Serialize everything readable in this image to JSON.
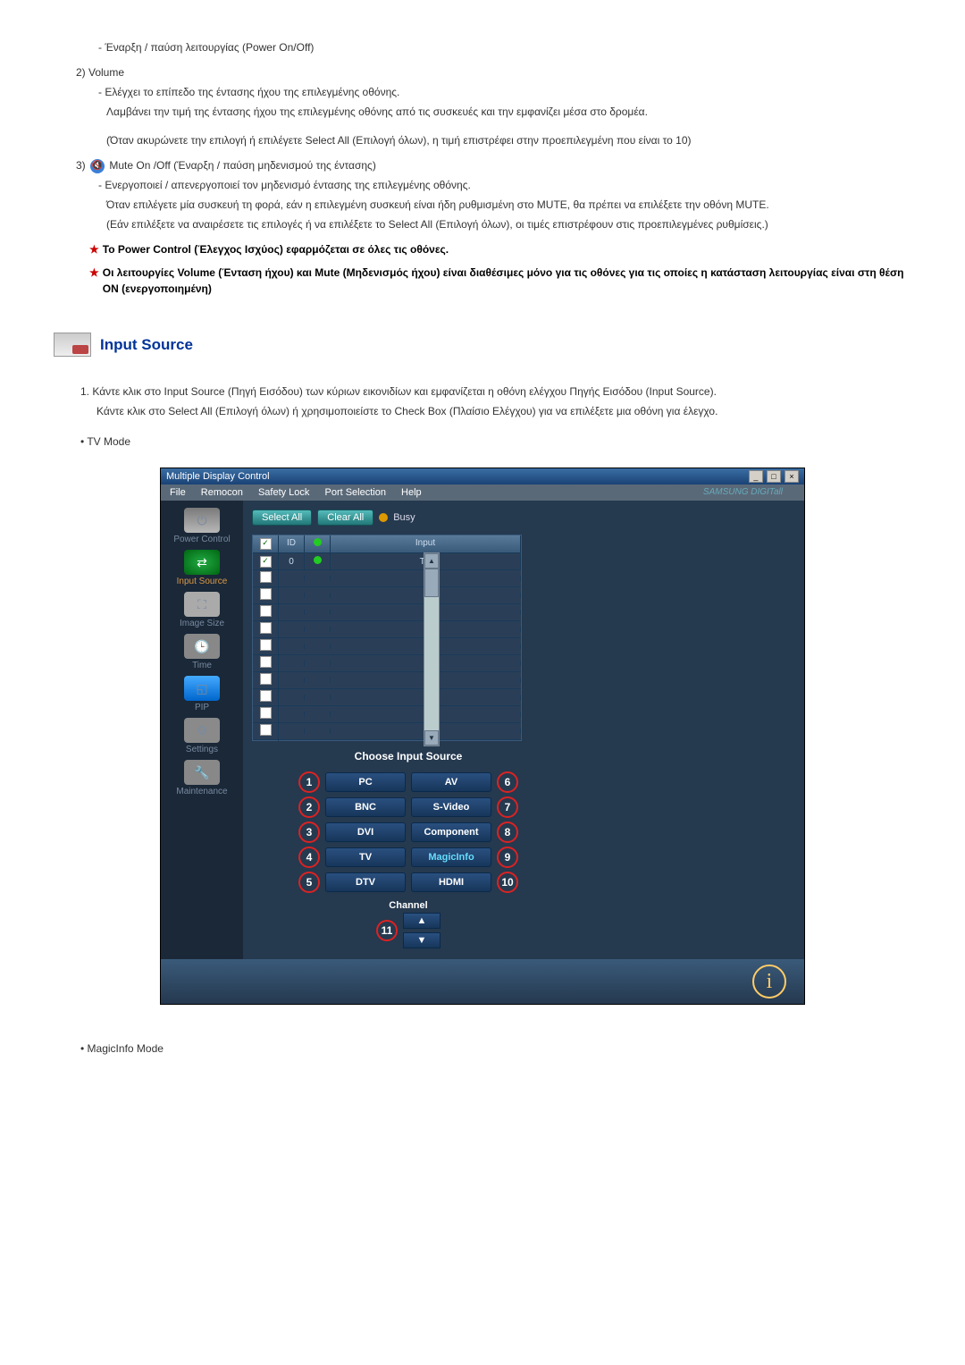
{
  "item1": {
    "dash": "- Έναρξη / παύση λειτουργίας (Power On/Off)"
  },
  "item2": {
    "label": "2)  Volume",
    "dash1": "- Ελέγχει το επίπεδο της έντασης ήχου της επιλεγμένης οθόνης.",
    "line2": "Λαμβάνει την τιμή της έντασης ήχου της επιλεγμένης οθόνης από τις συσκευές και την εμφανίζει μέσα στο δρομέα.",
    "line3": "(Όταν ακυρώνετε την επιλογή ή επιλέγετε Select All (Επιλογή όλων), η τιμή επιστρέφει στην προεπιλεγμένη που είναι το 10)"
  },
  "item3": {
    "label_pre": "3)",
    "label_post": "Mute On /Off (Έναρξη / παύση μηδενισμού της έντασης)",
    "dash1": "- Ενεργοποιεί / απενεργοποιεί τον μηδενισμό έντασης της επιλεγμένης οθόνης.",
    "line2": "Όταν επιλέγετε μία συσκευή τη φορά, εάν η επιλεγμένη συσκευή είναι ήδη ρυθμισμένη στο MUTE, θα πρέπει να επιλέξετε την οθόνη MUTE.",
    "line3": "(Εάν επιλέξετε να αναιρέσετε τις επιλογές ή να επιλέξετε το Select All (Επιλογή όλων), οι τιμές επιστρέφουν στις προεπιλεγμένες ρυθμίσεις.)"
  },
  "star1": "Το Power Control (Έλεγχος Ισχύος) εφαρμόζεται σε όλες τις οθόνες.",
  "star2": "Οι λειτουργίες Volume (Ένταση ήχου) και Mute (Μηδενισμός ήχου) είναι διαθέσιμες μόνο για τις οθόνες για τις οποίες η κατάσταση λειτουργίας είναι στη θέση ON (ενεργοποιημένη)",
  "section_title": "Input Source",
  "numlist": {
    "n1": "1.  Κάντε κλικ στο Input Source (Πηγή Εισόδου) των κύριων εικονιδίων και εμφανίζεται η οθόνη ελέγχου Πηγής Εισόδου (Input Source).",
    "n1b": "Κάντε κλικ στο Select All (Επιλογή όλων) ή χρησιμοποιείστε το Check Box (Πλαίσιο Ελέγχου) για να επιλέξετε μια οθόνη για έλεγχο."
  },
  "bullet_tv": "TV Mode",
  "bullet_magic": "MagicInfo Mode",
  "screenshot": {
    "title": "Multiple Display Control",
    "menu": {
      "file": "File",
      "remocon": "Remocon",
      "safety": "Safety Lock",
      "port": "Port Selection",
      "help": "Help",
      "brand": "SAMSUNG DIGITall"
    },
    "btn_selectall": "Select All",
    "btn_clearall": "Clear All",
    "busy": "Busy",
    "sidebar": {
      "pc": "Power Control",
      "is": "Input Source",
      "sz": "Image Size",
      "tm": "Time",
      "pip": "PIP",
      "st": "Settings",
      "mt": "Maintenance"
    },
    "table": {
      "h_id": "ID",
      "h_input": "Input",
      "row0_id": "0",
      "row0_input": "TV"
    },
    "right": {
      "head": "Choose Input Source",
      "n1": "1",
      "b1": "PC",
      "n2": "2",
      "b2": "BNC",
      "n3": "3",
      "b3": "DVI",
      "n4": "4",
      "b4": "TV",
      "n5": "5",
      "b5": "DTV",
      "n6": "6",
      "b6": "AV",
      "n7": "7",
      "b7": "S-Video",
      "n8": "8",
      "b8": "Component",
      "n9": "9",
      "b9": "MagicInfo",
      "n10": "10",
      "b10": "HDMI",
      "n11": "11",
      "channel": "Channel"
    }
  }
}
